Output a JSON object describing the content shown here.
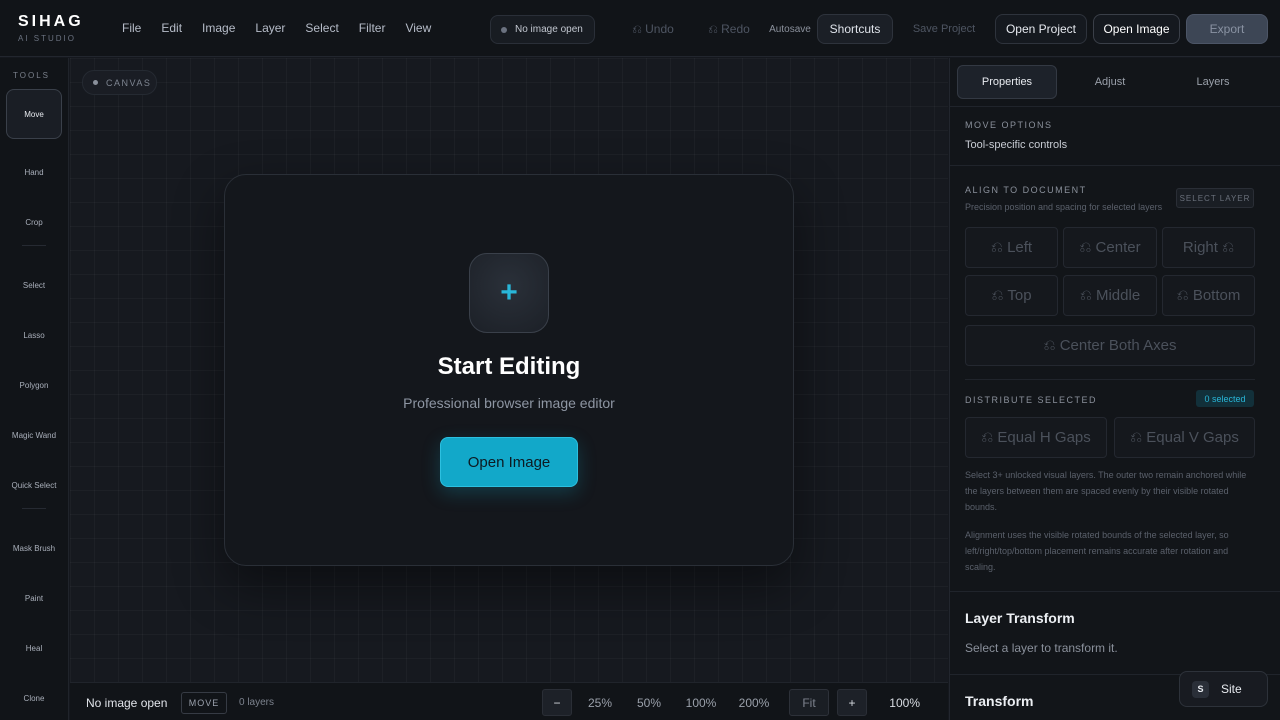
{
  "brand": {
    "name": "SIHAG",
    "sub": "AI STUDIO"
  },
  "menu": [
    "File",
    "Edit",
    "Image",
    "Layer",
    "Select",
    "Filter",
    "View"
  ],
  "header": {
    "status": "No image open",
    "undo": "⎌ Undo",
    "redo": "⎌ Redo",
    "autosave": "Autosave",
    "shortcuts": "Shortcuts",
    "save_project": "Save Project",
    "open_project": "Open Project",
    "open_image": "Open Image",
    "export": "Export"
  },
  "toolbar": {
    "title": "TOOLS",
    "tools": [
      "Move",
      "Hand",
      "Crop",
      "Select",
      "Lasso",
      "Polygon",
      "Magic Wand",
      "Quick Select",
      "Mask Brush",
      "Paint",
      "Heal",
      "Clone"
    ],
    "active": "Move"
  },
  "canvas": {
    "chip": "CANVAS",
    "title": "Start Editing",
    "subtitle": "Professional browser image editor",
    "button": "Open Image",
    "plus": "+"
  },
  "statusbar": {
    "image": "No image open",
    "mode": "MOVE",
    "layers": "0 layers",
    "minus": "−",
    "z25": "25%",
    "z50": "50%",
    "z100": "100%",
    "z200": "200%",
    "fit": "Fit",
    "plus": "+",
    "zoom": "100%"
  },
  "panel": {
    "tabs": [
      "Properties",
      "Adjust",
      "Layers"
    ],
    "active_tab": "Properties",
    "move_options_title": "MOVE OPTIONS",
    "move_options_text": "Tool-specific controls",
    "align_title": "ALIGN TO DOCUMENT",
    "align_sub": "Precision position and spacing for selected layers",
    "select_layer": "SELECT LAYER",
    "align_buttons": [
      "⎌ Left",
      "⎌ Center",
      "Right ⎌",
      "⎌ Top",
      "⎌ Middle",
      "⎌ Bottom"
    ],
    "center_both": "⎌ Center Both Axes",
    "distribute_title": "DISTRIBUTE SELECTED",
    "selected_count": "0 selected",
    "equal_h": "⎌ Equal H Gaps",
    "equal_v": "⎌ Equal V Gaps",
    "distribute_note": "Select 3+ unlocked visual layers. The outer two remain anchored while the layers between them are spaced evenly by their visible rotated bounds.",
    "align_note": "Alignment uses the visible rotated bounds of the selected layer, so left/right/top/bottom placement remains accurate after rotation and scaling.",
    "layer_transform_title": "Layer Transform",
    "layer_transform_sub": "Select a layer to transform it.",
    "transform_title": "Transform"
  },
  "site": {
    "icon": "S",
    "label": "Site"
  },
  "colors": {
    "accent": "#12a8c9",
    "background": "#15181e",
    "panel": "#121519"
  }
}
